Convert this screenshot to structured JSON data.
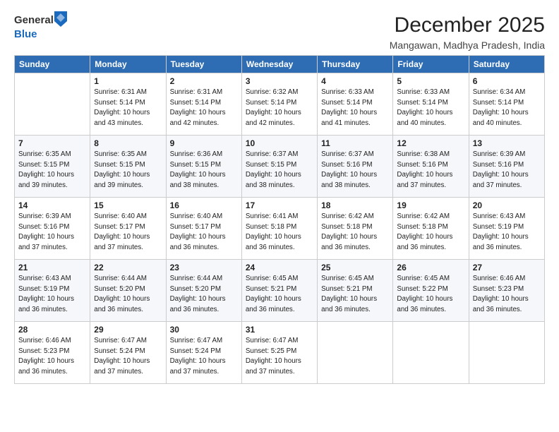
{
  "header": {
    "logo_general": "General",
    "logo_blue": "Blue",
    "title": "December 2025",
    "subtitle": "Mangawan, Madhya Pradesh, India"
  },
  "days_of_week": [
    "Sunday",
    "Monday",
    "Tuesday",
    "Wednesday",
    "Thursday",
    "Friday",
    "Saturday"
  ],
  "weeks": [
    [
      {
        "day": "",
        "sunrise": "",
        "sunset": "",
        "daylight": ""
      },
      {
        "day": "1",
        "sunrise": "Sunrise: 6:31 AM",
        "sunset": "Sunset: 5:14 PM",
        "daylight": "Daylight: 10 hours and 43 minutes."
      },
      {
        "day": "2",
        "sunrise": "Sunrise: 6:31 AM",
        "sunset": "Sunset: 5:14 PM",
        "daylight": "Daylight: 10 hours and 42 minutes."
      },
      {
        "day": "3",
        "sunrise": "Sunrise: 6:32 AM",
        "sunset": "Sunset: 5:14 PM",
        "daylight": "Daylight: 10 hours and 42 minutes."
      },
      {
        "day": "4",
        "sunrise": "Sunrise: 6:33 AM",
        "sunset": "Sunset: 5:14 PM",
        "daylight": "Daylight: 10 hours and 41 minutes."
      },
      {
        "day": "5",
        "sunrise": "Sunrise: 6:33 AM",
        "sunset": "Sunset: 5:14 PM",
        "daylight": "Daylight: 10 hours and 40 minutes."
      },
      {
        "day": "6",
        "sunrise": "Sunrise: 6:34 AM",
        "sunset": "Sunset: 5:14 PM",
        "daylight": "Daylight: 10 hours and 40 minutes."
      }
    ],
    [
      {
        "day": "7",
        "sunrise": "Sunrise: 6:35 AM",
        "sunset": "Sunset: 5:15 PM",
        "daylight": "Daylight: 10 hours and 39 minutes."
      },
      {
        "day": "8",
        "sunrise": "Sunrise: 6:35 AM",
        "sunset": "Sunset: 5:15 PM",
        "daylight": "Daylight: 10 hours and 39 minutes."
      },
      {
        "day": "9",
        "sunrise": "Sunrise: 6:36 AM",
        "sunset": "Sunset: 5:15 PM",
        "daylight": "Daylight: 10 hours and 38 minutes."
      },
      {
        "day": "10",
        "sunrise": "Sunrise: 6:37 AM",
        "sunset": "Sunset: 5:15 PM",
        "daylight": "Daylight: 10 hours and 38 minutes."
      },
      {
        "day": "11",
        "sunrise": "Sunrise: 6:37 AM",
        "sunset": "Sunset: 5:16 PM",
        "daylight": "Daylight: 10 hours and 38 minutes."
      },
      {
        "day": "12",
        "sunrise": "Sunrise: 6:38 AM",
        "sunset": "Sunset: 5:16 PM",
        "daylight": "Daylight: 10 hours and 37 minutes."
      },
      {
        "day": "13",
        "sunrise": "Sunrise: 6:39 AM",
        "sunset": "Sunset: 5:16 PM",
        "daylight": "Daylight: 10 hours and 37 minutes."
      }
    ],
    [
      {
        "day": "14",
        "sunrise": "Sunrise: 6:39 AM",
        "sunset": "Sunset: 5:16 PM",
        "daylight": "Daylight: 10 hours and 37 minutes."
      },
      {
        "day": "15",
        "sunrise": "Sunrise: 6:40 AM",
        "sunset": "Sunset: 5:17 PM",
        "daylight": "Daylight: 10 hours and 37 minutes."
      },
      {
        "day": "16",
        "sunrise": "Sunrise: 6:40 AM",
        "sunset": "Sunset: 5:17 PM",
        "daylight": "Daylight: 10 hours and 36 minutes."
      },
      {
        "day": "17",
        "sunrise": "Sunrise: 6:41 AM",
        "sunset": "Sunset: 5:18 PM",
        "daylight": "Daylight: 10 hours and 36 minutes."
      },
      {
        "day": "18",
        "sunrise": "Sunrise: 6:42 AM",
        "sunset": "Sunset: 5:18 PM",
        "daylight": "Daylight: 10 hours and 36 minutes."
      },
      {
        "day": "19",
        "sunrise": "Sunrise: 6:42 AM",
        "sunset": "Sunset: 5:18 PM",
        "daylight": "Daylight: 10 hours and 36 minutes."
      },
      {
        "day": "20",
        "sunrise": "Sunrise: 6:43 AM",
        "sunset": "Sunset: 5:19 PM",
        "daylight": "Daylight: 10 hours and 36 minutes."
      }
    ],
    [
      {
        "day": "21",
        "sunrise": "Sunrise: 6:43 AM",
        "sunset": "Sunset: 5:19 PM",
        "daylight": "Daylight: 10 hours and 36 minutes."
      },
      {
        "day": "22",
        "sunrise": "Sunrise: 6:44 AM",
        "sunset": "Sunset: 5:20 PM",
        "daylight": "Daylight: 10 hours and 36 minutes."
      },
      {
        "day": "23",
        "sunrise": "Sunrise: 6:44 AM",
        "sunset": "Sunset: 5:20 PM",
        "daylight": "Daylight: 10 hours and 36 minutes."
      },
      {
        "day": "24",
        "sunrise": "Sunrise: 6:45 AM",
        "sunset": "Sunset: 5:21 PM",
        "daylight": "Daylight: 10 hours and 36 minutes."
      },
      {
        "day": "25",
        "sunrise": "Sunrise: 6:45 AM",
        "sunset": "Sunset: 5:21 PM",
        "daylight": "Daylight: 10 hours and 36 minutes."
      },
      {
        "day": "26",
        "sunrise": "Sunrise: 6:45 AM",
        "sunset": "Sunset: 5:22 PM",
        "daylight": "Daylight: 10 hours and 36 minutes."
      },
      {
        "day": "27",
        "sunrise": "Sunrise: 6:46 AM",
        "sunset": "Sunset: 5:23 PM",
        "daylight": "Daylight: 10 hours and 36 minutes."
      }
    ],
    [
      {
        "day": "28",
        "sunrise": "Sunrise: 6:46 AM",
        "sunset": "Sunset: 5:23 PM",
        "daylight": "Daylight: 10 hours and 36 minutes."
      },
      {
        "day": "29",
        "sunrise": "Sunrise: 6:47 AM",
        "sunset": "Sunset: 5:24 PM",
        "daylight": "Daylight: 10 hours and 37 minutes."
      },
      {
        "day": "30",
        "sunrise": "Sunrise: 6:47 AM",
        "sunset": "Sunset: 5:24 PM",
        "daylight": "Daylight: 10 hours and 37 minutes."
      },
      {
        "day": "31",
        "sunrise": "Sunrise: 6:47 AM",
        "sunset": "Sunset: 5:25 PM",
        "daylight": "Daylight: 10 hours and 37 minutes."
      },
      {
        "day": "",
        "sunrise": "",
        "sunset": "",
        "daylight": ""
      },
      {
        "day": "",
        "sunrise": "",
        "sunset": "",
        "daylight": ""
      },
      {
        "day": "",
        "sunrise": "",
        "sunset": "",
        "daylight": ""
      }
    ]
  ],
  "colors": {
    "header_bg": "#2e6db4",
    "header_text": "#ffffff",
    "row_alt_bg": "#f5f7fa",
    "border": "#cccccc"
  }
}
